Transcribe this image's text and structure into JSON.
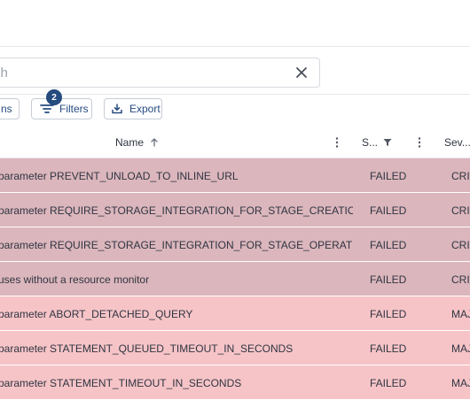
{
  "search": {
    "placeholder": "ch"
  },
  "toolbar": {
    "columns_label": "ns",
    "filters_label": "Filters",
    "filters_count": "2",
    "export_label": "Export"
  },
  "table": {
    "headers": {
      "name": "Name",
      "status": "S...",
      "severity": "Sev..."
    },
    "rows": [
      {
        "name": "parameter PREVENT_UNLOAD_TO_INLINE_URL",
        "status": "FAILED",
        "severity": "CRIT",
        "tone": "critical"
      },
      {
        "name": "parameter REQUIRE_STORAGE_INTEGRATION_FOR_STAGE_CREATION",
        "status": "FAILED",
        "severity": "CRIT",
        "tone": "critical"
      },
      {
        "name": "parameter REQUIRE_STORAGE_INTEGRATION_FOR_STAGE_OPERATION",
        "status": "FAILED",
        "severity": "CRIT",
        "tone": "critical"
      },
      {
        "name": "uses without a resource monitor",
        "status": "FAILED",
        "severity": "CRIT",
        "tone": "critical"
      },
      {
        "name": "parameter ABORT_DETACHED_QUERY",
        "status": "FAILED",
        "severity": "MAJ",
        "tone": "major"
      },
      {
        "name": "parameter STATEMENT_QUEUED_TIMEOUT_IN_SECONDS",
        "status": "FAILED",
        "severity": "MAJ",
        "tone": "major"
      },
      {
        "name": "parameter STATEMENT_TIMEOUT_IN_SECONDS",
        "status": "FAILED",
        "severity": "MAJ",
        "tone": "major"
      }
    ]
  },
  "colors": {
    "critical_row": "#dbb6bc",
    "major_row": "#f6c4c7",
    "accent": "#254b7f"
  },
  "icons": {
    "clear": "close-icon",
    "filters": "filter-lines-icon",
    "export": "download-icon",
    "sort": "arrow-up-icon",
    "menu": "kebab-icon",
    "status_filter": "funnel-icon"
  }
}
